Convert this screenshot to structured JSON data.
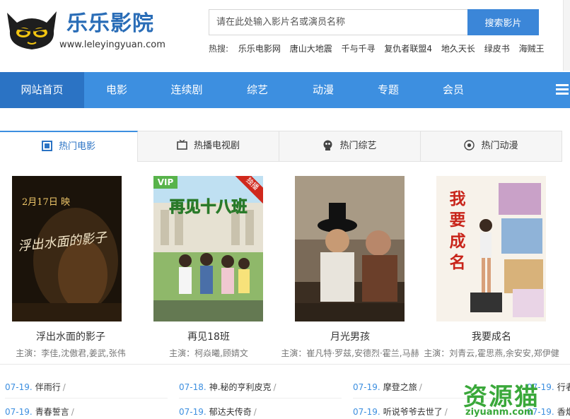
{
  "brand": {
    "title": "乐乐影院",
    "url": "www.leleyingyuan.com",
    "logo_icon": "cat-face-icon"
  },
  "search": {
    "placeholder": "请在此处输入影片名或演员名称",
    "button": "搜索影片",
    "hot_label": "热搜:",
    "hot_items": [
      "乐乐电影网",
      "唐山大地震",
      "千与千寻",
      "复仇者联盟4",
      "地久天长",
      "绿皮书",
      "海贼王"
    ]
  },
  "nav": {
    "items": [
      "网站首页",
      "电影",
      "连续剧",
      "综艺",
      "动漫",
      "专题",
      "会员"
    ],
    "active": "网站首页",
    "menu_icon": "hamburger-menu-icon"
  },
  "tabs": [
    {
      "label": "热门电影",
      "icon": "film-icon",
      "active": true
    },
    {
      "label": "热播电视剧",
      "icon": "tv-icon",
      "active": false
    },
    {
      "label": "热门综艺",
      "icon": "variety-icon",
      "active": false
    },
    {
      "label": "热门动漫",
      "icon": "anime-icon",
      "active": false
    }
  ],
  "movies": [
    {
      "title": "浮出水面的影子",
      "cast": "主演：李佳,沈傲君,姜武,张伟",
      "poster_text": "浮出水面的影子",
      "poster_date": "2月17日 映",
      "badge": ""
    },
    {
      "title": "再见18班",
      "cast": "主演：柯焱曦,顾婧文",
      "poster_text": "再见十八班",
      "poster_date": "",
      "badge": "VIP",
      "corner": "独播"
    },
    {
      "title": "月光男孩",
      "cast": "主演：崔凡特·罗兹,安德烈·霍兰,马赫",
      "poster_text": "",
      "poster_date": "",
      "badge": ""
    },
    {
      "title": "我要成名",
      "cast": "主演：刘青云,霍思燕,余安安,郑伊健",
      "poster_text": "我要成名",
      "poster_date": "",
      "badge": ""
    }
  ],
  "updates": [
    {
      "date": "07-19.",
      "title": "伴雨行"
    },
    {
      "date": "07-18.",
      "title": "神.秘的亨利皮克"
    },
    {
      "date": "07-19.",
      "title": "摩登之旅"
    },
    {
      "date": "07-19.",
      "title": "行者"
    },
    {
      "date": "07-19.",
      "title": "青春誓言"
    },
    {
      "date": "07-19.",
      "title": "郁达夫传奇"
    },
    {
      "date": "07-19.",
      "title": "听说爷爷去世了"
    },
    {
      "date": "07-19.",
      "title": "香烟"
    }
  ],
  "watermark": {
    "cn": "资源猫",
    "url": "ziyuanm.com"
  },
  "colors": {
    "accent": "#3d8fe0",
    "accent_dark": "#2b73c4",
    "date": "#3d8fe0",
    "watermark": "#3aa83a"
  }
}
